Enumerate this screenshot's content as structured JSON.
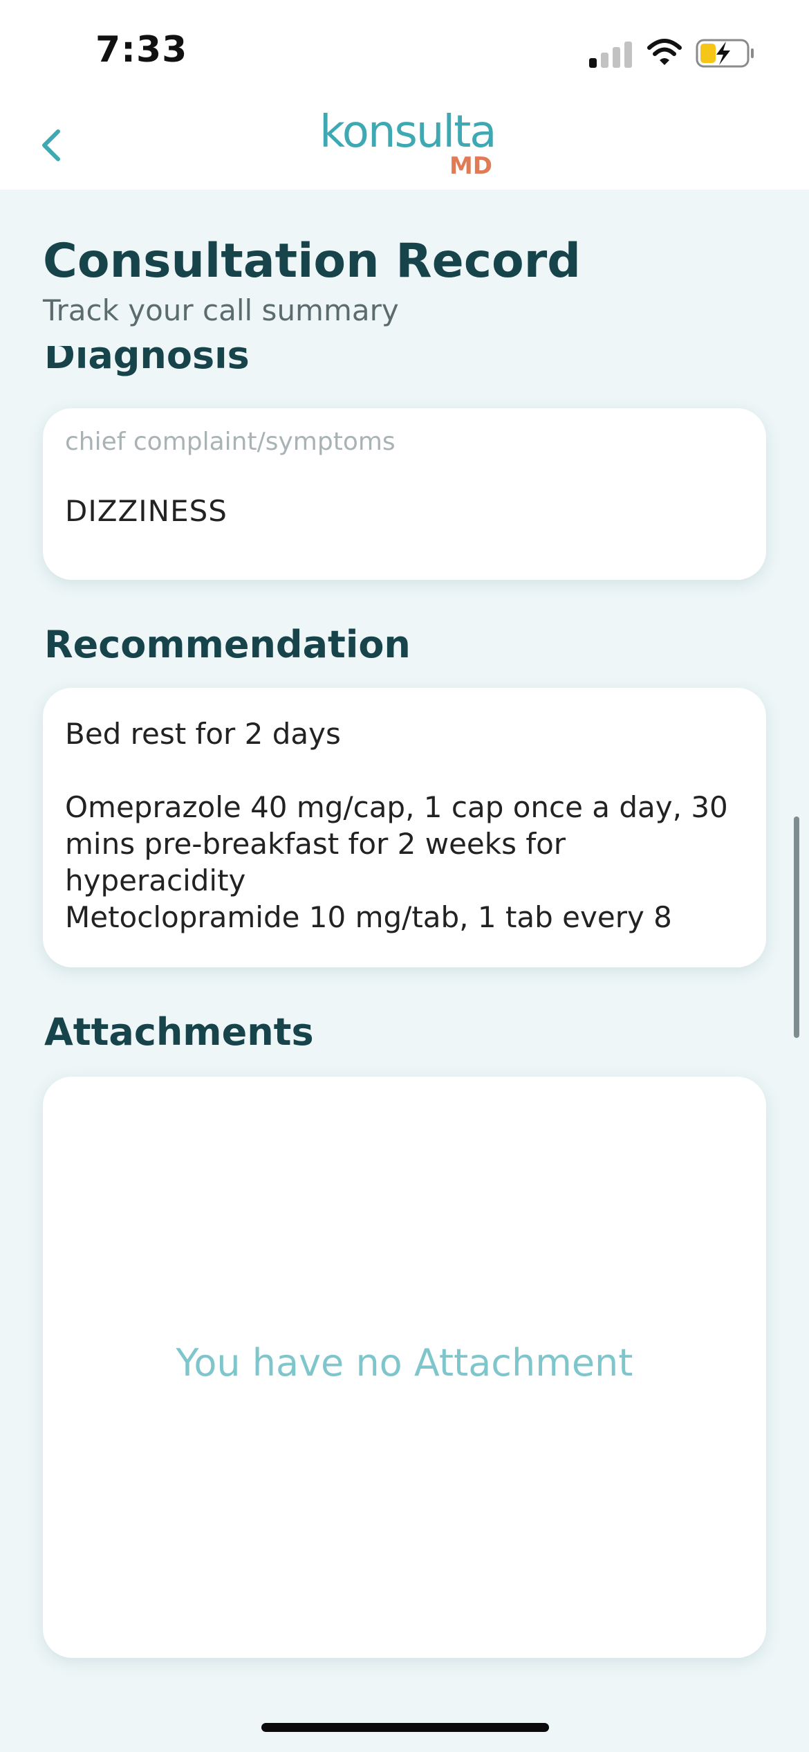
{
  "status_bar": {
    "time": "7:33",
    "signal_icon": "cellular-signal-icon",
    "wifi_icon": "wifi-icon",
    "battery_icon": "battery-charging-icon",
    "battery_color": "#f5c518",
    "signal_bars_active": 1,
    "signal_bars_total": 4
  },
  "header": {
    "back_icon": "chevron-left-icon",
    "logo_main": "konsulta",
    "logo_sub": "MD",
    "logo_colors": {
      "main": "#3ea8b3",
      "sub": "#e07b55"
    }
  },
  "page": {
    "title": "Consultation Record",
    "subtitle": "Track your call summary"
  },
  "diagnosis": {
    "heading": "Diagnosis",
    "field_label": "chief complaint/symptoms",
    "field_value": "DIZZINESS"
  },
  "recommendation": {
    "heading": "Recommendation",
    "text": "Bed rest for 2 days\n\nOmeprazole 40 mg/cap, 1 cap once a day, 30 mins pre-breakfast for 2 weeks for hyperacidity\nMetoclopramide 10 mg/tab, 1 tab every 8"
  },
  "attachments": {
    "heading": "Attachments",
    "empty_message": "You have no Attachment"
  },
  "colors": {
    "background": "#eef6f7",
    "accent": "#3ea8b3",
    "heading": "#17434a",
    "empty_text": "#7fc6cc"
  }
}
